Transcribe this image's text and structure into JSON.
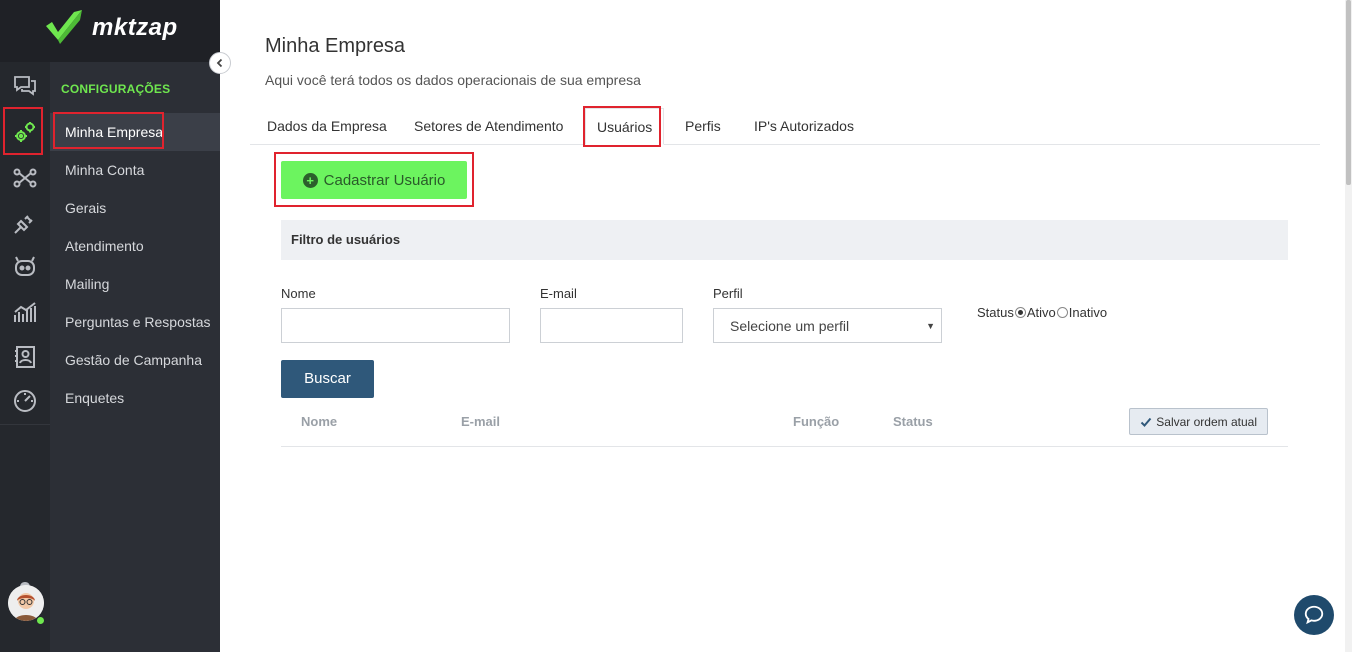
{
  "brand": {
    "name": "mktzap",
    "accent": "#6fe74f"
  },
  "sidebar": {
    "heading": "CONFIGURAÇÕES",
    "items": [
      {
        "label": "Minha Empresa",
        "active": true
      },
      {
        "label": "Minha Conta"
      },
      {
        "label": "Gerais"
      },
      {
        "label": "Atendimento"
      },
      {
        "label": "Mailing"
      },
      {
        "label": "Perguntas e Respostas"
      },
      {
        "label": "Gestão de Campanha"
      },
      {
        "label": "Enquetes"
      }
    ],
    "rail_icons": [
      "chat-icon",
      "gears-icon",
      "flow-icon",
      "plug-icon",
      "bot-icon",
      "chart-icon",
      "contacts-icon",
      "speedometer-icon",
      "bell-icon"
    ]
  },
  "page": {
    "title": "Minha Empresa",
    "subtitle": "Aqui você terá todos os dados operacionais de sua empresa"
  },
  "tabs": [
    {
      "label": "Dados da Empresa"
    },
    {
      "label": "Setores de Atendimento"
    },
    {
      "label": "Usuários",
      "active": true
    },
    {
      "label": "Perfis"
    },
    {
      "label": "IP's Autorizados"
    }
  ],
  "actions": {
    "add_user": "Cadastrar Usuário",
    "search": "Buscar",
    "save_order": "Salvar ordem atual"
  },
  "filter": {
    "title": "Filtro de usuários",
    "name_label": "Nome",
    "email_label": "E-mail",
    "profile_label": "Perfil",
    "profile_selected": "Selecione um perfil",
    "status_label": "Status",
    "status_options": [
      "Ativo",
      "Inativo"
    ],
    "status_selected": "Ativo"
  },
  "table": {
    "columns": [
      "Nome",
      "E-mail",
      "Função",
      "Status"
    ]
  }
}
